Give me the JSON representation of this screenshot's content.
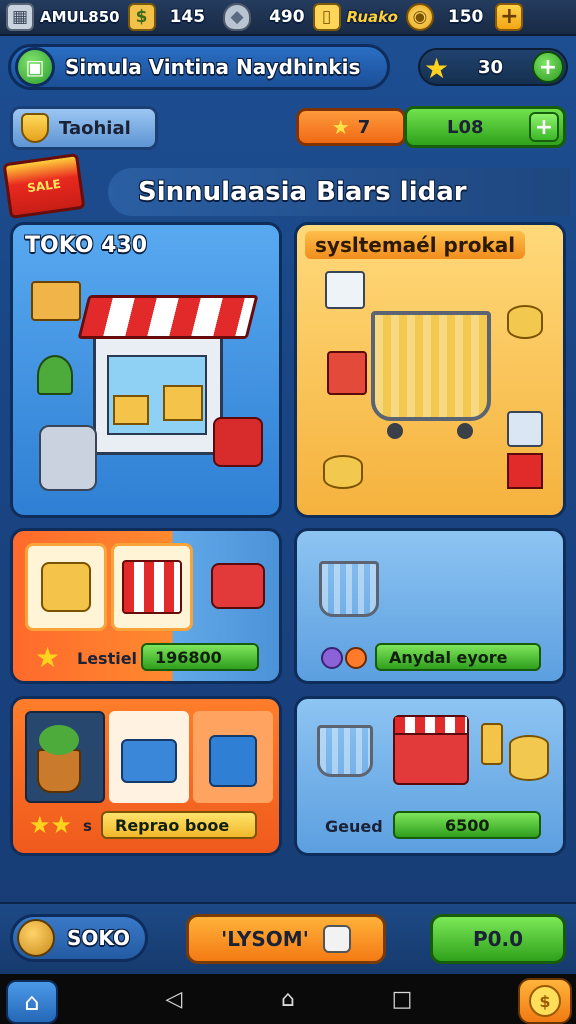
{
  "topbar": {
    "resources": [
      {
        "icon": "basket-icon",
        "value": "AMUL850"
      },
      {
        "icon": "cash-icon",
        "value": "145"
      },
      {
        "icon": "gem-icon",
        "value": "490"
      },
      {
        "icon": "wallet-icon",
        "value": "Ruako"
      },
      {
        "icon": "gold-coin-icon",
        "value": "150"
      }
    ],
    "plus_label": "+"
  },
  "header": {
    "title": "Simula Vintina Naydhinkis",
    "stars_value": "30",
    "plus_label": "+"
  },
  "row2": {
    "tab_label": "Taohial",
    "orange_counter": "7",
    "green_counter": "L08",
    "plus_label": "+"
  },
  "banner": {
    "title": "Sinnulaasia Biars lidar",
    "tag_text": "SALE"
  },
  "cards": {
    "store": {
      "label": "TOKO 430"
    },
    "cart": {
      "label": "sysltemaél prokal"
    },
    "items": {
      "bar_label": "Lestiel",
      "bar_value": "196800"
    },
    "cart2": {
      "bar_value": "Anydal eyore"
    },
    "plants": {
      "bar_value": "Reprao booe",
      "star_text": "s"
    },
    "market": {
      "label": "Geued",
      "bar_value": "6500"
    }
  },
  "bottom": {
    "soko_label": "SOKO",
    "middle_label": "'LYSOM'",
    "right_label": "P0.0"
  },
  "colors": {
    "green": "#2fa11b",
    "orange": "#f47a14",
    "blue": "#2f7fd4"
  }
}
